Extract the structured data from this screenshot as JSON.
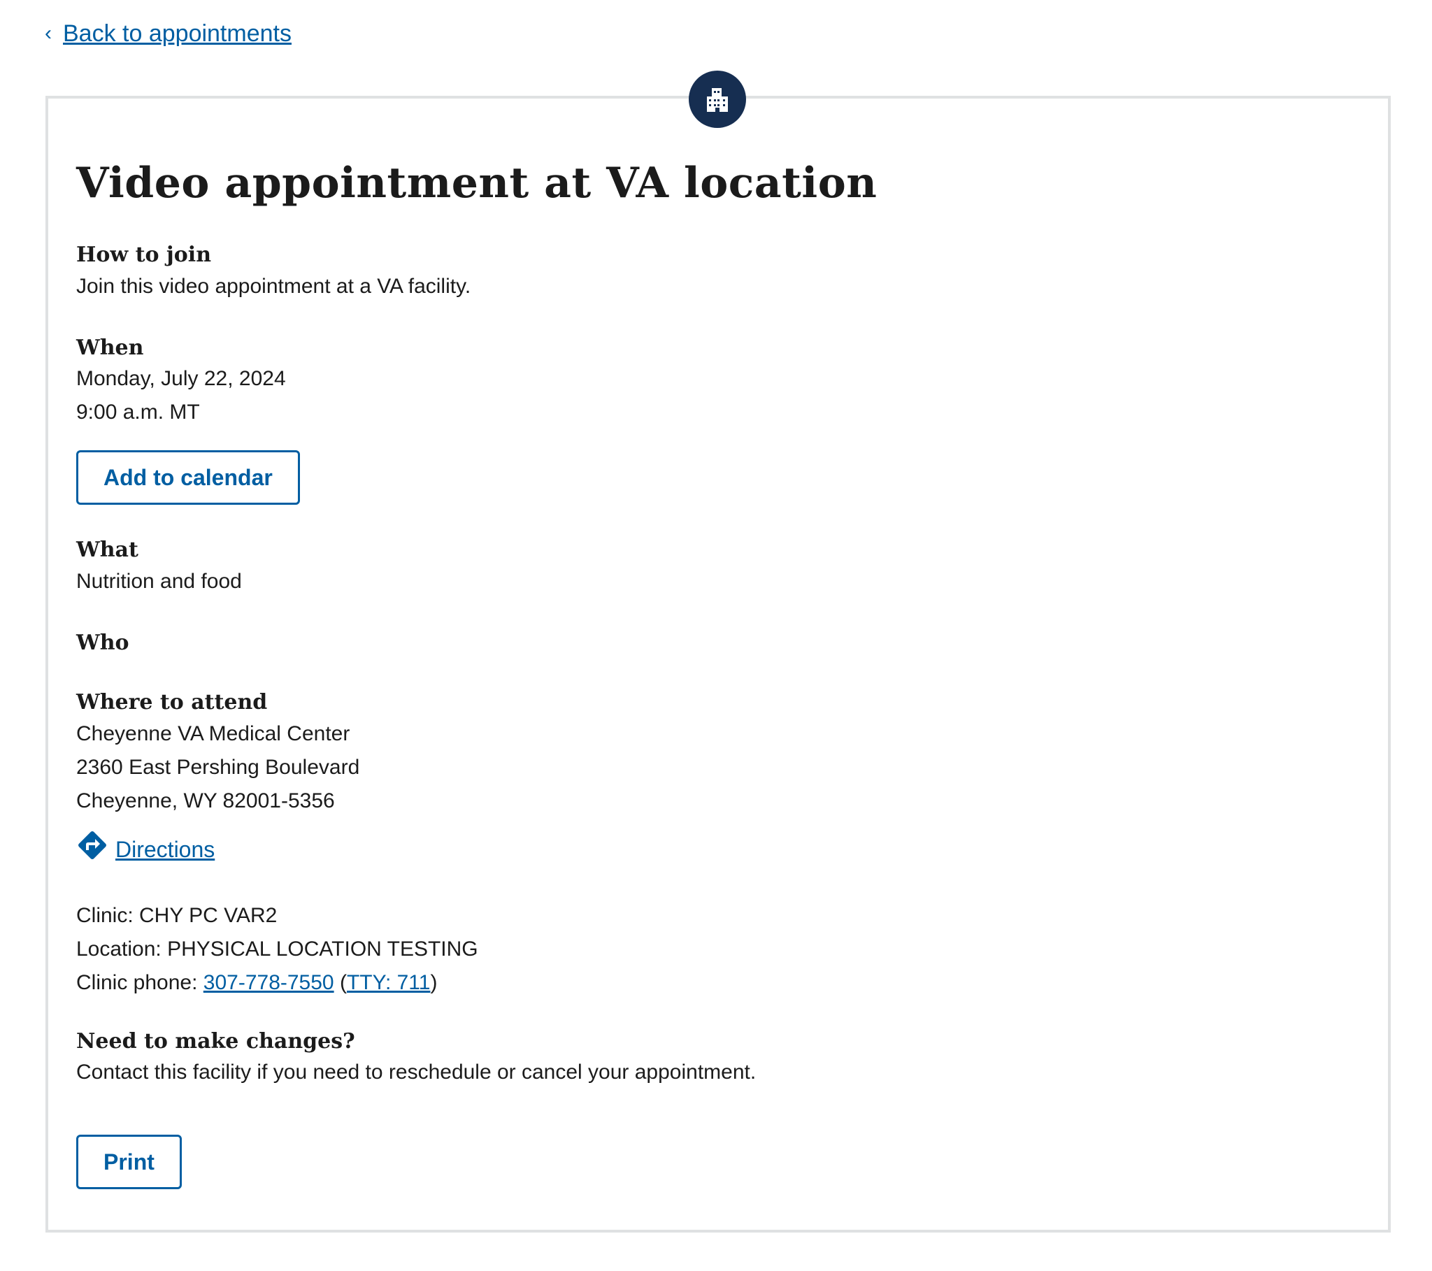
{
  "nav": {
    "back_chevron": "‹",
    "back_label": "Back to appointments"
  },
  "header_icon": "building-icon",
  "page_title": "Video appointment at VA location",
  "how_to_join": {
    "heading": "How to join",
    "text": "Join this video appointment at a VA facility."
  },
  "when": {
    "heading": "When",
    "date": "Monday, July 22, 2024",
    "time": "9:00 a.m. MT"
  },
  "add_to_calendar_label": "Add to calendar",
  "what": {
    "heading": "What",
    "text": "Nutrition and food"
  },
  "who": {
    "heading": "Who"
  },
  "where": {
    "heading": "Where to attend",
    "facility_name": "Cheyenne VA Medical Center",
    "address_line1": "2360 East Pershing Boulevard",
    "address_line2": "Cheyenne, WY 82001-5356",
    "directions_label": "Directions",
    "directions_icon": "directions-icon"
  },
  "clinic": {
    "clinic_line": "Clinic: CHY PC VAR2",
    "location_line": "Location: PHYSICAL LOCATION TESTING",
    "phone_prefix": "Clinic phone: ",
    "phone_number": "307-778-7550",
    "open_paren": " (",
    "tty_label": "TTY: 711",
    "close_paren": ")"
  },
  "changes": {
    "heading": "Need to make changes?",
    "text": "Contact this facility if you need to reschedule or cancel your appointment."
  },
  "print_label": "Print",
  "colors": {
    "link": "#005ea2",
    "icon_background": "#162e51",
    "card_border": "#dfe1e2",
    "text": "#1b1b1b"
  }
}
